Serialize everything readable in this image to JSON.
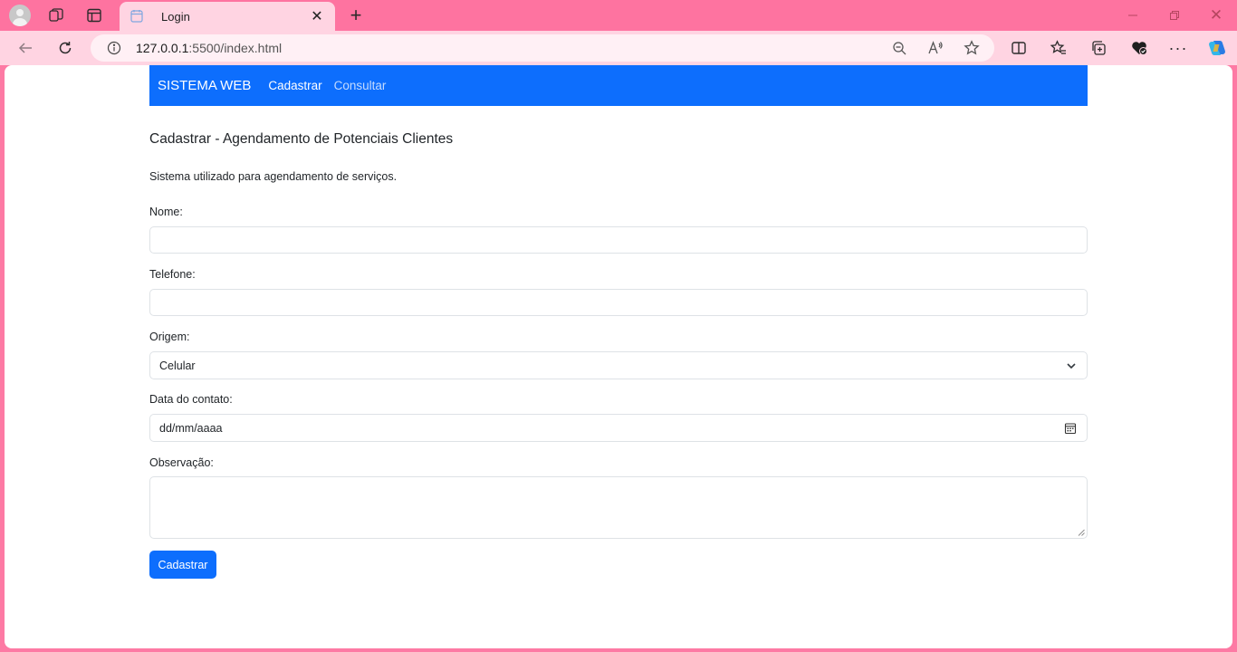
{
  "browser": {
    "tab_title": "Login",
    "url_host": "127.0.0.1",
    "url_path": ":5500/index.html"
  },
  "navbar": {
    "brand": "SISTEMA WEB",
    "links": [
      "Cadastrar",
      "Consultar"
    ]
  },
  "page": {
    "title": "Cadastrar - Agendamento de Potenciais Clientes",
    "description": "Sistema utilizado para agendamento de serviços."
  },
  "form": {
    "nome_label": "Nome:",
    "telefone_label": "Telefone:",
    "origem_label": "Origem:",
    "origem_value": "Celular",
    "data_label": "Data do contato:",
    "data_placeholder": "dd/mm/aaaa",
    "observacao_label": "Observação:",
    "submit_label": "Cadastrar"
  },
  "colors": {
    "navbar": "#0d6efd",
    "button": "#0d6efd",
    "tabstrip": "#fe73a0",
    "toolbar": "#ffd4e2"
  }
}
